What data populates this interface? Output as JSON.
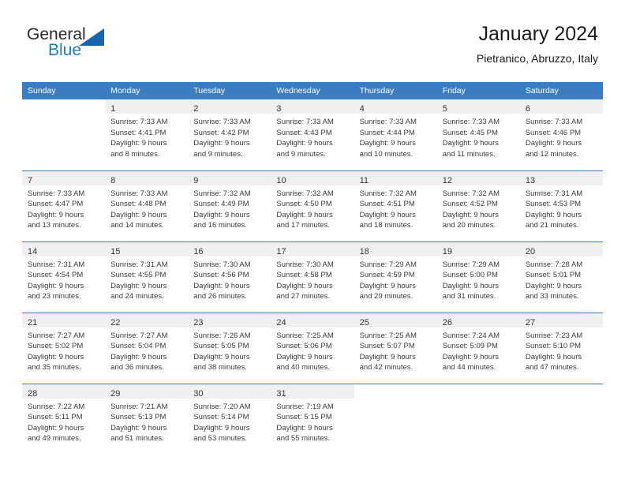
{
  "brand": {
    "name_part1": "General",
    "name_part2": "Blue",
    "triangle_color": "#1566ad",
    "blue_color": "#1f7ac0"
  },
  "header": {
    "title": "January 2024",
    "subtitle": "Pietranico, Abruzzo, Italy"
  },
  "theme": {
    "header_blue": "#3b7dc0",
    "daynum_band": "#f0f0f0"
  },
  "weekday_headers": [
    "Sunday",
    "Monday",
    "Tuesday",
    "Wednesday",
    "Thursday",
    "Friday",
    "Saturday"
  ],
  "weeks": [
    [
      {
        "day": "",
        "lines": []
      },
      {
        "day": "1",
        "lines": [
          "Sunrise: 7:33 AM",
          "Sunset: 4:41 PM",
          "Daylight: 9 hours",
          "and 8 minutes."
        ]
      },
      {
        "day": "2",
        "lines": [
          "Sunrise: 7:33 AM",
          "Sunset: 4:42 PM",
          "Daylight: 9 hours",
          "and 9 minutes."
        ]
      },
      {
        "day": "3",
        "lines": [
          "Sunrise: 7:33 AM",
          "Sunset: 4:43 PM",
          "Daylight: 9 hours",
          "and 9 minutes."
        ]
      },
      {
        "day": "4",
        "lines": [
          "Sunrise: 7:33 AM",
          "Sunset: 4:44 PM",
          "Daylight: 9 hours",
          "and 10 minutes."
        ]
      },
      {
        "day": "5",
        "lines": [
          "Sunrise: 7:33 AM",
          "Sunset: 4:45 PM",
          "Daylight: 9 hours",
          "and 11 minutes."
        ]
      },
      {
        "day": "6",
        "lines": [
          "Sunrise: 7:33 AM",
          "Sunset: 4:46 PM",
          "Daylight: 9 hours",
          "and 12 minutes."
        ]
      }
    ],
    [
      {
        "day": "7",
        "lines": [
          "Sunrise: 7:33 AM",
          "Sunset: 4:47 PM",
          "Daylight: 9 hours",
          "and 13 minutes."
        ]
      },
      {
        "day": "8",
        "lines": [
          "Sunrise: 7:33 AM",
          "Sunset: 4:48 PM",
          "Daylight: 9 hours",
          "and 14 minutes."
        ]
      },
      {
        "day": "9",
        "lines": [
          "Sunrise: 7:32 AM",
          "Sunset: 4:49 PM",
          "Daylight: 9 hours",
          "and 16 minutes."
        ]
      },
      {
        "day": "10",
        "lines": [
          "Sunrise: 7:32 AM",
          "Sunset: 4:50 PM",
          "Daylight: 9 hours",
          "and 17 minutes."
        ]
      },
      {
        "day": "11",
        "lines": [
          "Sunrise: 7:32 AM",
          "Sunset: 4:51 PM",
          "Daylight: 9 hours",
          "and 18 minutes."
        ]
      },
      {
        "day": "12",
        "lines": [
          "Sunrise: 7:32 AM",
          "Sunset: 4:52 PM",
          "Daylight: 9 hours",
          "and 20 minutes."
        ]
      },
      {
        "day": "13",
        "lines": [
          "Sunrise: 7:31 AM",
          "Sunset: 4:53 PM",
          "Daylight: 9 hours",
          "and 21 minutes."
        ]
      }
    ],
    [
      {
        "day": "14",
        "lines": [
          "Sunrise: 7:31 AM",
          "Sunset: 4:54 PM",
          "Daylight: 9 hours",
          "and 23 minutes."
        ]
      },
      {
        "day": "15",
        "lines": [
          "Sunrise: 7:31 AM",
          "Sunset: 4:55 PM",
          "Daylight: 9 hours",
          "and 24 minutes."
        ]
      },
      {
        "day": "16",
        "lines": [
          "Sunrise: 7:30 AM",
          "Sunset: 4:56 PM",
          "Daylight: 9 hours",
          "and 26 minutes."
        ]
      },
      {
        "day": "17",
        "lines": [
          "Sunrise: 7:30 AM",
          "Sunset: 4:58 PM",
          "Daylight: 9 hours",
          "and 27 minutes."
        ]
      },
      {
        "day": "18",
        "lines": [
          "Sunrise: 7:29 AM",
          "Sunset: 4:59 PM",
          "Daylight: 9 hours",
          "and 29 minutes."
        ]
      },
      {
        "day": "19",
        "lines": [
          "Sunrise: 7:29 AM",
          "Sunset: 5:00 PM",
          "Daylight: 9 hours",
          "and 31 minutes."
        ]
      },
      {
        "day": "20",
        "lines": [
          "Sunrise: 7:28 AM",
          "Sunset: 5:01 PM",
          "Daylight: 9 hours",
          "and 33 minutes."
        ]
      }
    ],
    [
      {
        "day": "21",
        "lines": [
          "Sunrise: 7:27 AM",
          "Sunset: 5:02 PM",
          "Daylight: 9 hours",
          "and 35 minutes."
        ]
      },
      {
        "day": "22",
        "lines": [
          "Sunrise: 7:27 AM",
          "Sunset: 5:04 PM",
          "Daylight: 9 hours",
          "and 36 minutes."
        ]
      },
      {
        "day": "23",
        "lines": [
          "Sunrise: 7:26 AM",
          "Sunset: 5:05 PM",
          "Daylight: 9 hours",
          "and 38 minutes."
        ]
      },
      {
        "day": "24",
        "lines": [
          "Sunrise: 7:25 AM",
          "Sunset: 5:06 PM",
          "Daylight: 9 hours",
          "and 40 minutes."
        ]
      },
      {
        "day": "25",
        "lines": [
          "Sunrise: 7:25 AM",
          "Sunset: 5:07 PM",
          "Daylight: 9 hours",
          "and 42 minutes."
        ]
      },
      {
        "day": "26",
        "lines": [
          "Sunrise: 7:24 AM",
          "Sunset: 5:09 PM",
          "Daylight: 9 hours",
          "and 44 minutes."
        ]
      },
      {
        "day": "27",
        "lines": [
          "Sunrise: 7:23 AM",
          "Sunset: 5:10 PM",
          "Daylight: 9 hours",
          "and 47 minutes."
        ]
      }
    ],
    [
      {
        "day": "28",
        "lines": [
          "Sunrise: 7:22 AM",
          "Sunset: 5:11 PM",
          "Daylight: 9 hours",
          "and 49 minutes."
        ]
      },
      {
        "day": "29",
        "lines": [
          "Sunrise: 7:21 AM",
          "Sunset: 5:13 PM",
          "Daylight: 9 hours",
          "and 51 minutes."
        ]
      },
      {
        "day": "30",
        "lines": [
          "Sunrise: 7:20 AM",
          "Sunset: 5:14 PM",
          "Daylight: 9 hours",
          "and 53 minutes."
        ]
      },
      {
        "day": "31",
        "lines": [
          "Sunrise: 7:19 AM",
          "Sunset: 5:15 PM",
          "Daylight: 9 hours",
          "and 55 minutes."
        ]
      },
      {
        "day": "",
        "lines": []
      },
      {
        "day": "",
        "lines": []
      },
      {
        "day": "",
        "lines": []
      }
    ]
  ]
}
